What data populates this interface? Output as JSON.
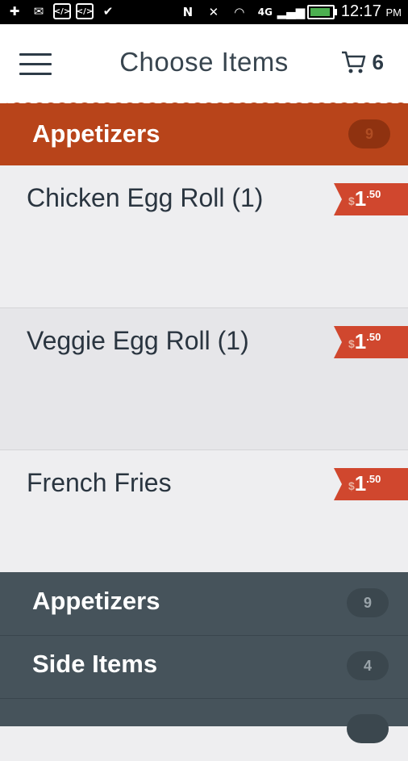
{
  "status_bar": {
    "time": "12:17",
    "ampm": "PM",
    "network": "4G"
  },
  "header": {
    "title": "Choose Items",
    "cart_count": "6"
  },
  "category": {
    "title": "Appetizers",
    "count": "9"
  },
  "items": [
    {
      "name": "Chicken Egg Roll (1)",
      "currency": "$",
      "dollars": "1",
      "cents": ".50"
    },
    {
      "name": "Veggie Egg Roll (1)",
      "currency": "$",
      "dollars": "1",
      "cents": ".50"
    },
    {
      "name": "French Fries",
      "currency": "$",
      "dollars": "1",
      "cents": ".50"
    }
  ],
  "nav": [
    {
      "label": "Appetizers",
      "count": "9"
    },
    {
      "label": "Side Items",
      "count": "4"
    }
  ],
  "colors": {
    "accent": "#b8441a",
    "price_tag": "#d0472e",
    "nav_bg": "#46535b"
  }
}
